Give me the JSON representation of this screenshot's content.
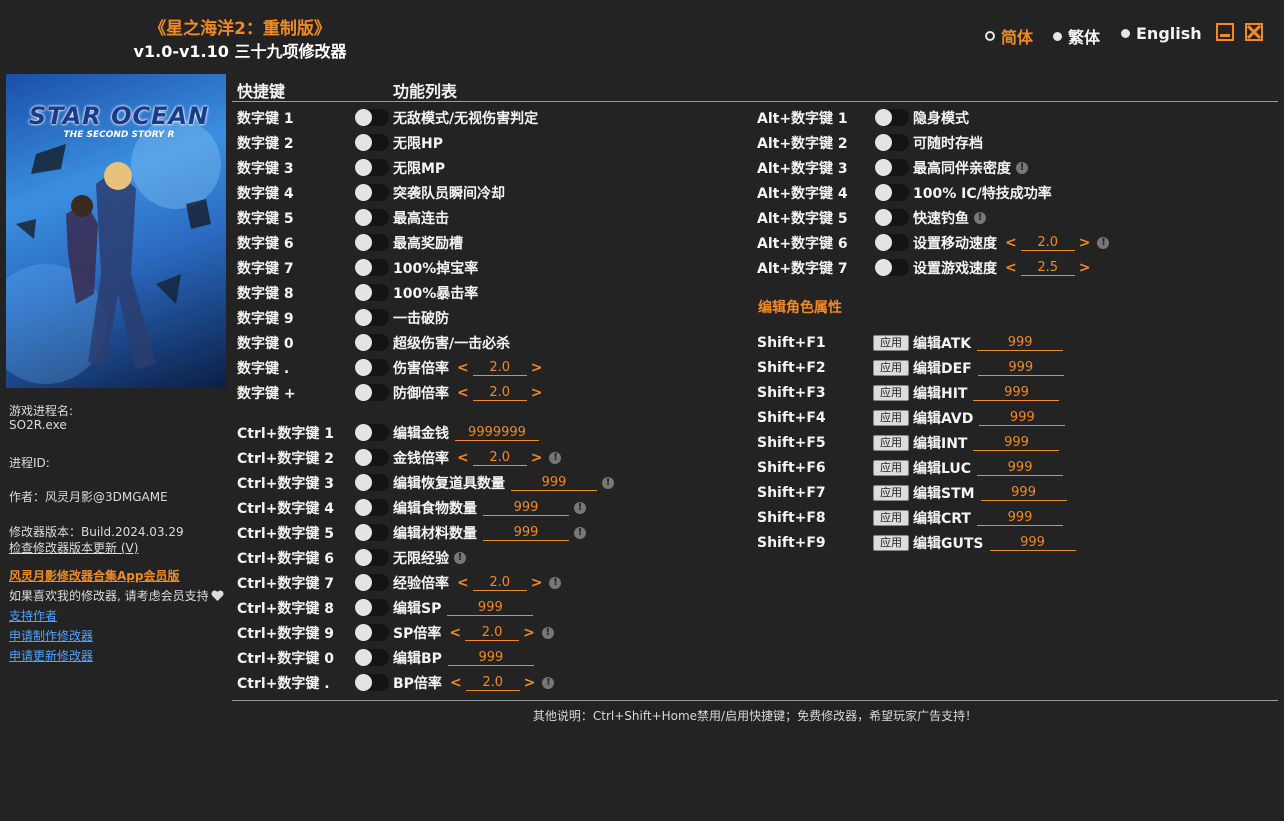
{
  "app": {
    "title": "《星之海洋2：重制版》",
    "subtitle": "v1.0-v1.10 三十九项修改器",
    "languages": [
      "简体",
      "繁体",
      "English"
    ],
    "selected_language": "简体"
  },
  "sidebar": {
    "process_label": "游戏进程名:",
    "process_value": "SO2R.exe",
    "pid_label": "进程ID:",
    "author": "作者：风灵月影@3DMGAME",
    "version": "修改器版本：Build.2024.03.29",
    "check_update": "检查修改器版本更新 (V)",
    "app_promo": "风灵月影修改器合集App会员版",
    "support_text": "如果喜欢我的修改器, 请考虑会员支持",
    "support_author": "支持作者",
    "request_make": "申请制作修改器",
    "request_update": "申请更新修改器"
  },
  "headers": {
    "hotkey": "快捷键",
    "feature_list": "功能列表"
  },
  "left_rows": [
    {
      "key": "数字键 1",
      "label": "无敌模式/无视伤害判定"
    },
    {
      "key": "数字键 2",
      "label": "无限HP"
    },
    {
      "key": "数字键 3",
      "label": "无限MP"
    },
    {
      "key": "数字键 4",
      "label": "突袭队员瞬间冷却"
    },
    {
      "key": "数字键 5",
      "label": "最高连击"
    },
    {
      "key": "数字键 6",
      "label": "最高奖励槽"
    },
    {
      "key": "数字键 7",
      "label": "100%掉宝率"
    },
    {
      "key": "数字键 8",
      "label": "100%暴击率"
    },
    {
      "key": "数字键 9",
      "label": "一击破防"
    },
    {
      "key": "数字键 0",
      "label": "超级伤害/一击必杀"
    },
    {
      "key": "数字键 .",
      "label": "伤害倍率",
      "value": "2.0"
    },
    {
      "key": "数字键 +",
      "label": "防御倍率",
      "value": "2.0"
    },
    {
      "key": "Ctrl+数字键 1",
      "label": "编辑金钱",
      "field": "9999999"
    },
    {
      "key": "Ctrl+数字键 2",
      "label": "金钱倍率",
      "value": "2.0",
      "info": true
    },
    {
      "key": "Ctrl+数字键 3",
      "label": "编辑恢复道具数量",
      "field": "999",
      "info": true
    },
    {
      "key": "Ctrl+数字键 4",
      "label": "编辑食物数量",
      "field": "999",
      "info": true
    },
    {
      "key": "Ctrl+数字键 5",
      "label": "编辑材料数量",
      "field": "999",
      "info": true
    },
    {
      "key": "Ctrl+数字键 6",
      "label": "无限经验",
      "info": true
    },
    {
      "key": "Ctrl+数字键 7",
      "label": "经验倍率",
      "value": "2.0",
      "info": true
    },
    {
      "key": "Ctrl+数字键 8",
      "label": "编辑SP",
      "field": "999"
    },
    {
      "key": "Ctrl+数字键 9",
      "label": "SP倍率",
      "value": "2.0",
      "info": true
    },
    {
      "key": "Ctrl+数字键 0",
      "label": "编辑BP",
      "field": "999"
    },
    {
      "key": "Ctrl+数字键 .",
      "label": "BP倍率",
      "value": "2.0",
      "info": true
    }
  ],
  "right_rows": [
    {
      "key": "Alt+数字键 1",
      "label": "隐身模式"
    },
    {
      "key": "Alt+数字键 2",
      "label": "可随时存档"
    },
    {
      "key": "Alt+数字键 3",
      "label": "最高同伴亲密度",
      "info": true
    },
    {
      "key": "Alt+数字键 4",
      "label": "100% IC/特技成功率"
    },
    {
      "key": "Alt+数字键 5",
      "label": "快速钓鱼",
      "info": true
    },
    {
      "key": "Alt+数字键 6",
      "label": "设置移动速度",
      "value": "2.0",
      "info": true
    },
    {
      "key": "Alt+数字键 7",
      "label": "设置游戏速度",
      "value": "2.5"
    }
  ],
  "attr_section": "编辑角色属性",
  "apply_label": "应用",
  "attr_rows": [
    {
      "key": "Shift+F1",
      "label": "编辑ATK",
      "field": "999"
    },
    {
      "key": "Shift+F2",
      "label": "编辑DEF",
      "field": "999"
    },
    {
      "key": "Shift+F3",
      "label": "编辑HIT",
      "field": "999"
    },
    {
      "key": "Shift+F4",
      "label": "编辑AVD",
      "field": "999"
    },
    {
      "key": "Shift+F5",
      "label": "编辑INT",
      "field": "999"
    },
    {
      "key": "Shift+F6",
      "label": "编辑LUC",
      "field": "999"
    },
    {
      "key": "Shift+F7",
      "label": "编辑STM",
      "field": "999"
    },
    {
      "key": "Shift+F8",
      "label": "编辑CRT",
      "field": "999"
    },
    {
      "key": "Shift+F9",
      "label": "编辑GUTS",
      "field": "999"
    }
  ],
  "cover": {
    "logo": "STAR OCEAN",
    "tagline": "THE SECOND STORY R"
  },
  "footer": "其他说明：Ctrl+Shift+Home禁用/启用快捷键；免费修改器，希望玩家广告支持！",
  "colors": {
    "accent": "#f08a24",
    "background": "#232323",
    "link": "#4ea3ff"
  },
  "icons": {
    "minimize": "minimize-icon",
    "close": "close-icon",
    "info": "info-icon",
    "heart": "heart-icon"
  }
}
